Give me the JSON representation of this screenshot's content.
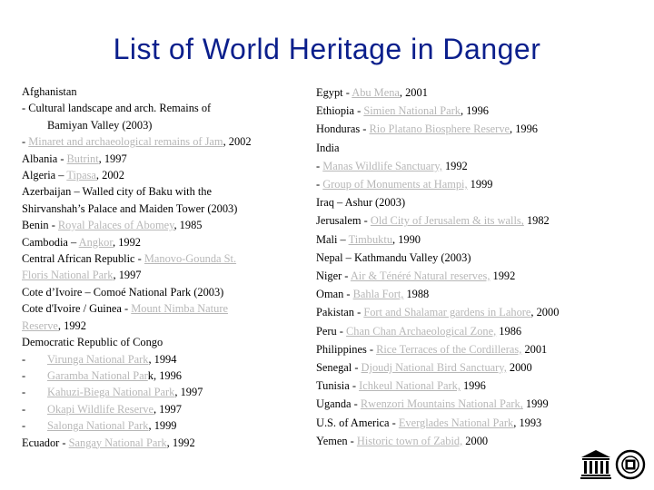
{
  "title": "List of World Heritage in Danger",
  "left": {
    "afghanistan": "Afghanistan",
    "l2_text": "- Cultural landscape and arch. Remains of",
    "l3_text": "Bamiyan Valley (2003)",
    "l4_prefix": "- ",
    "l4_link": "Minaret and archaeological remains of Jam",
    "l4_suffix": ", 2002",
    "l5_prefix": "Albania - ",
    "l5_link": "Butrint",
    "l5_suffix": ", 1997",
    "l6_prefix": "Algeria – ",
    "l6_link": "Tipasa",
    "l6_suffix": ", 2002",
    "l7_text": "Azerbaijan – Walled city of Baku with the",
    "l8_text": "Shirvanshah’s Palace and Maiden Tower (2003)",
    "l9_prefix": "Benin - ",
    "l9_link": "Royal Palaces of Abomey",
    "l9_suffix": ", 1985",
    "l10_prefix": "Cambodia – ",
    "l10_link": "Angkor",
    "l10_suffix": ", 1992",
    "l11_prefix": "Central African Republic - ",
    "l11_link": "Manovo-Gounda St.",
    "l12_link": "Floris National Park",
    "l12_suffix": ", 1997",
    "l13_text": "Cote d’Ivoire – Comoé National Park (2003)",
    "l14_prefix": "Cote d'Ivoire / Guinea - ",
    "l14_link": "Mount Nimba Nature",
    "l15_link": "Reserve",
    "l15_suffix": ", 1992",
    "l16_text": "Democratic Republic of Congo",
    "congo_items": [
      {
        "dash": "-",
        "link": "Virunga National Park",
        "suffix": ", 1994"
      },
      {
        "dash": "-",
        "link": "Garamba National Par",
        "suffix": "k, 1996"
      },
      {
        "dash": "-",
        "link": "Kahuzi-Biega National Park",
        "suffix": ", 1997"
      },
      {
        "dash": "-",
        "link": "Okapi Wildlife Reserve",
        "suffix": ", 1997"
      },
      {
        "dash": "-",
        "link": "Salonga National Park",
        "suffix": ", 1999"
      }
    ],
    "l22_prefix": "Ecuador - ",
    "l22_link": "Sangay National Park",
    "l22_suffix": ", 1992"
  },
  "right": {
    "r1_prefix": "Egypt - ",
    "r1_link": "Abu Mena",
    "r1_suffix": ", 2001",
    "r2_prefix": "Ethiopia - ",
    "r2_link": "Simien National Park",
    "r2_suffix": ", 1996",
    "r3_prefix": "Honduras - ",
    "r3_link": "Rio Platano Biosphere Reserve",
    "r3_suffix": ", 1996",
    "r4_text": "India",
    "r5_prefix": "- ",
    "r5_link": "Manas Wildlife Sanctuary,",
    "r5_suffix": " 1992",
    "r6_prefix": "- ",
    "r6_link": "Group of Monuments at Hampi,",
    "r6_suffix": " 1999",
    "r7_text": "Iraq – Ashur (2003)",
    "r8_prefix": "Jerusalem - ",
    "r8_link": "Old City of Jerusalem & its walls,",
    "r8_suffix": " 1982",
    "r9_prefix": "Mali – ",
    "r9_link": "Timbuktu",
    "r9_suffix": ", 1990",
    "r10_text": "Nepal – Kathmandu Valley (2003)",
    "r11_prefix": "Niger - ",
    "r11_link": "Air & Ténéré Natural reserves,",
    "r11_suffix": " 1992",
    "r12_prefix": "Oman - ",
    "r12_link": "Bahla Fort,",
    "r12_suffix": " 1988",
    "r13_prefix": "Pakistan - ",
    "r13_link": "Fort and Shalamar gardens in Lahore",
    "r13_suffix": ", 2000",
    "r14_prefix": "Peru - ",
    "r14_link": "Chan Chan Archaeological Zone,",
    "r14_suffix": " 1986",
    "r15_prefix": "Philippines - ",
    "r15_link": "Rice Terraces of the Cordilleras,",
    "r15_suffix": " 2001",
    "r16_prefix": "Senegal - ",
    "r16_link": "Djoudj National Bird Sanctuary,",
    "r16_suffix": " 2000",
    "r17_prefix": "Tunisia - ",
    "r17_link": "Ichkeul National Park,",
    "r17_suffix": " 1996",
    "r18_prefix": "Uganda - ",
    "r18_link": "Rwenzori Mountains National Park,",
    "r18_suffix": " 1999",
    "r19_prefix": "U.S. of America - ",
    "r19_link": "Everglades National Park",
    "r19_suffix": ", 1993",
    "r20_prefix": "Yemen - ",
    "r20_link": "Historic town of Zabid,",
    "r20_suffix": " 2000"
  },
  "logos": [
    "unesco-temple-icon",
    "world-heritage-emblem-icon"
  ]
}
